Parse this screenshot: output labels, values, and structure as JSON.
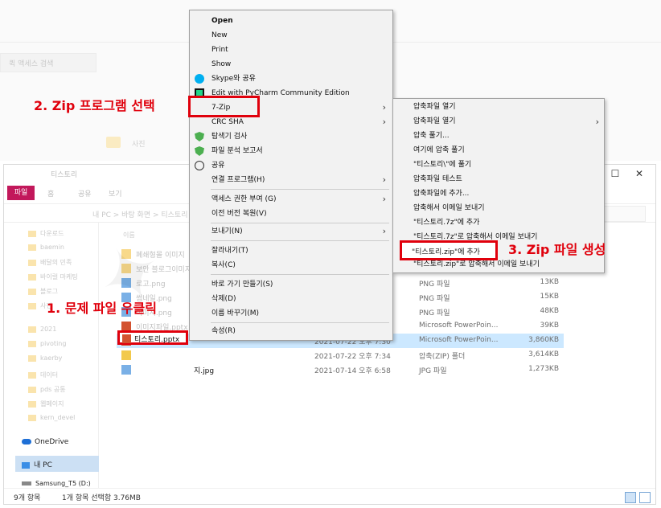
{
  "background": {
    "search_placeholder": "퀵 액세스 검색",
    "folder_label": "사진"
  },
  "window": {
    "title": "티스토리",
    "ribbon": {
      "file_tab": "파일",
      "home_tab": "홈",
      "share_tab": "공유",
      "view_tab": "보기"
    },
    "address": "내 PC  >  바탕 화면  >  티스토리",
    "close_icon": "✕",
    "minimize_icon": "—",
    "maximize_icon": "☐",
    "help_icon": "?",
    "expand_icon": "⌄"
  },
  "nav": {
    "items": [
      "다운로드",
      "baemin",
      "배달의 민족",
      "바이럴 마케팅",
      "블로그",
      "사진",
      "2021",
      "pivoting",
      "kaerby",
      "데이터",
      "pds 공통",
      "웹페이지",
      "kern_devel"
    ],
    "onedrive": "OneDrive",
    "this_pc": "내 PC",
    "drive": "Samsung_T5 (D:)"
  },
  "list": {
    "header_name": "이름",
    "rows": [
      {
        "name": "폐쇄형몰 이미지",
        "date": "",
        "type": "",
        "size": "",
        "icon": "folder"
      },
      {
        "name": "보안 블로그이미지",
        "date": "",
        "type": "",
        "size": "",
        "icon": "folder"
      },
      {
        "name": "로고.png",
        "date": "",
        "type": "PNG 파일",
        "size": "13KB",
        "icon": "png"
      },
      {
        "name": "썸네일.png",
        "date": "",
        "type": "PNG 파일",
        "size": "15KB",
        "icon": "png"
      },
      {
        "name": "이미지.png",
        "date": "",
        "type": "PNG 파일",
        "size": "48KB",
        "icon": "png"
      },
      {
        "name": "이미지파일.pptx",
        "date": "",
        "type": "Microsoft PowerPoin...",
        "size": "39KB",
        "icon": "ppt"
      },
      {
        "name": "",
        "date": "2021-07-22 오후 7:30",
        "type": "Microsoft PowerPoin...",
        "size": "3,860KB",
        "icon": "ppt"
      },
      {
        "name": "",
        "date": "2021-07-22 오후 7:34",
        "type": "압축(ZIP) 폴더",
        "size": "3,614KB",
        "icon": "zip"
      },
      {
        "name": "지.jpg",
        "date": "2021-07-14 오후 6:58",
        "type": "JPG 파일",
        "size": "1,273KB",
        "icon": "jpg"
      }
    ],
    "selected_file": "티스토리.pptx"
  },
  "status": {
    "count": "9개 항목",
    "selection": "1개 항목 선택함 3.76MB"
  },
  "context_menu": {
    "items": [
      {
        "label": "Open",
        "bold": true,
        "icon": "",
        "arrow": false
      },
      {
        "label": "New",
        "bold": false,
        "icon": "",
        "arrow": false
      },
      {
        "label": "Print",
        "bold": false,
        "icon": "",
        "arrow": false
      },
      {
        "label": "Show",
        "bold": false,
        "icon": "",
        "arrow": false
      },
      {
        "label": "Skype와 공유",
        "bold": false,
        "icon": "skype-icon",
        "arrow": false
      },
      {
        "label": "Edit with PyCharm Community Edition",
        "bold": false,
        "icon": "pycharm-icon",
        "arrow": false
      },
      {
        "label": "7-Zip",
        "bold": false,
        "icon": "",
        "arrow": true
      },
      {
        "label": "CRC SHA",
        "bold": false,
        "icon": "",
        "arrow": true
      },
      {
        "label": "탐색기 검사",
        "bold": false,
        "icon": "shield-icon",
        "arrow": false
      },
      {
        "label": "파일 분석 보고서",
        "bold": false,
        "icon": "shield-icon",
        "arrow": false
      },
      {
        "label": "공유",
        "bold": false,
        "icon": "share-icon",
        "arrow": false
      },
      {
        "label": "연결 프로그램(H)",
        "bold": false,
        "icon": "",
        "arrow": true
      },
      {
        "label": "액세스 권한 부여 (G)",
        "bold": false,
        "icon": "",
        "arrow": true
      },
      {
        "label": "이전 버전 복원(V)",
        "bold": false,
        "icon": "",
        "arrow": false
      },
      {
        "label": "보내기(N)",
        "bold": false,
        "icon": "",
        "arrow": true
      },
      {
        "label": "잘라내기(T)",
        "bold": false,
        "icon": "",
        "arrow": false
      },
      {
        "label": "복사(C)",
        "bold": false,
        "icon": "",
        "arrow": false
      },
      {
        "label": "바로 가기 만들기(S)",
        "bold": false,
        "icon": "",
        "arrow": false
      },
      {
        "label": "삭제(D)",
        "bold": false,
        "icon": "",
        "arrow": false
      },
      {
        "label": "이름 바꾸기(M)",
        "bold": false,
        "icon": "",
        "arrow": false
      },
      {
        "label": "속성(R)",
        "bold": false,
        "icon": "",
        "arrow": false
      }
    ]
  },
  "submenu": {
    "items": [
      {
        "label": "압축파일 열기",
        "arrow": false
      },
      {
        "label": "압축파일 열기",
        "arrow": true
      },
      {
        "label": "압축 풀기...",
        "arrow": false
      },
      {
        "label": "여기에 압축 풀기",
        "arrow": false
      },
      {
        "label": "\"티스토리\\\"에 풀기",
        "arrow": false
      },
      {
        "label": "압축파일 테스트",
        "arrow": false
      },
      {
        "label": "압축파일에 추가...",
        "arrow": false
      },
      {
        "label": "압축해서 이메일 보내기",
        "arrow": false
      },
      {
        "label": "\"티스토리.7z\"에 추가",
        "arrow": false
      },
      {
        "label": "\"티스토리.7z\"로 압축해서 이메일 보내기",
        "arrow": false
      },
      {
        "label": "\"티스토리.zip\"에 추가",
        "arrow": false
      },
      {
        "label": "\"티스토리.zip\"로 압축해서 이메일 보내기",
        "arrow": false
      }
    ]
  },
  "annotations": {
    "step1": "1. 문제 파일 우클릭",
    "step2": "2. Zip 프로그램 선택",
    "step3": "3. Zip 파일 생성"
  },
  "colors": {
    "highlight_red": "#e0000c",
    "selection_blue": "#cce8ff"
  }
}
